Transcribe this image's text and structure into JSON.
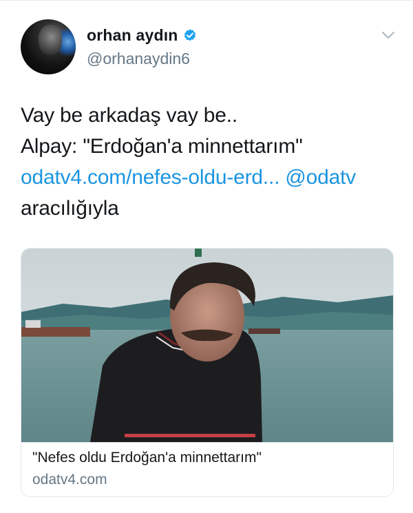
{
  "tweet": {
    "author": {
      "display_name": "orhan aydın",
      "handle": "@orhanaydin6",
      "verified": true
    },
    "text_lines": [
      "Vay be arkadaş vay be..",
      "Alpay: \"Erdoğan'a minnettarım\""
    ],
    "link_text": "odatv4.com/nefes-oldu-erd...",
    "mention": "@odatv",
    "via_text": "aracılığıyla",
    "card": {
      "title": "\"Nefes oldu Erdoğan'a minnettarım\"",
      "domain": "odatv4.com"
    }
  },
  "colors": {
    "link": "#1b95e0",
    "verified_badge": "#1da1f2",
    "secondary_text": "#657786"
  },
  "icons": [
    "verified-badge-icon",
    "chevron-down-icon"
  ]
}
